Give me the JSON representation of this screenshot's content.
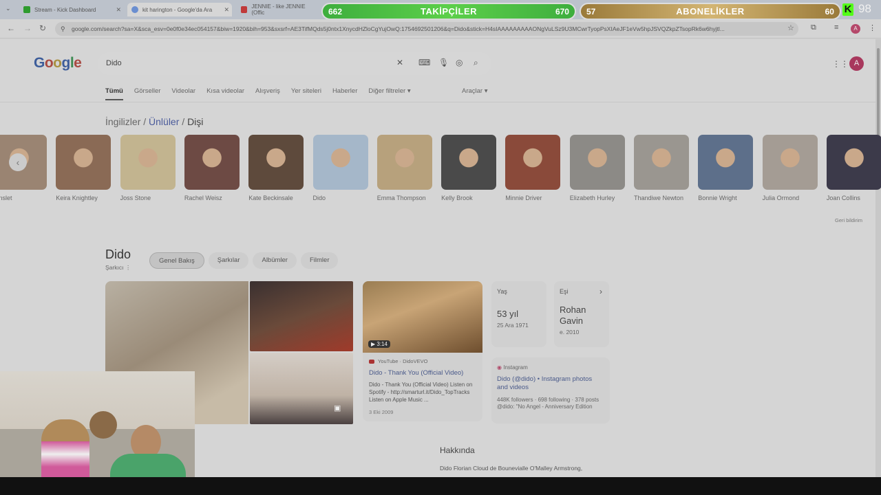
{
  "browser": {
    "tabs": [
      {
        "title": "Stream - Kick Dashboard",
        "color": "#53fc18"
      },
      {
        "title": "kit harington - Google'da Ara",
        "color": "#4285f4"
      },
      {
        "title": "JENNIE - like JENNIE (Offic",
        "color": "#e53935"
      }
    ],
    "url": "google.com/search?sa=X&sca_esv=0e0f0e34ec054157&biw=1920&bih=953&sxsrf=AE3TifMQds5j0ntx1XnycdHZloCgYujOwQ:1754692501206&q=Dido&stick=H4sIAAAAAAAAAONgVuLSz9U3MCwrTyopPsXIAeJF1eVw5hpJSVQZkpZTsopRk6w6hyjtl...",
    "profile_initial": "A"
  },
  "overlay": {
    "followers": {
      "label": "TAKİPÇİLER",
      "current": "662",
      "goal": "670"
    },
    "subscribers": {
      "label": "ABONELİKLER",
      "current": "57",
      "goal": "60"
    },
    "kick_logo": "K",
    "kick_count": "98"
  },
  "google": {
    "search_query": "Dido",
    "avatar_initial": "A",
    "filters": [
      "Tümü",
      "Görseller",
      "Videolar",
      "Kısa videolar",
      "Alışveriş",
      "Yer siteleri",
      "Haberler",
      "Diğer filtreler"
    ],
    "more_filters_caret": "▾",
    "tools": "Araçlar ▾",
    "breadcrumb": {
      "a": "İngilizler",
      "b": "Ünlüler",
      "c": "Dişi"
    },
    "people": [
      {
        "name": "Winslet",
        "color": "#9a8472"
      },
      {
        "name": "Keira Knightley",
        "color": "#8a6a55"
      },
      {
        "name": "Joss Stone",
        "color": "#c2b48f"
      },
      {
        "name": "Rachel Weisz",
        "color": "#6d4a44"
      },
      {
        "name": "Kate Beckinsale",
        "color": "#5e4a3c"
      },
      {
        "name": "Dido",
        "color": "#a5b7c9"
      },
      {
        "name": "Emma Thompson",
        "color": "#b7a17c"
      },
      {
        "name": "Kelly Brook",
        "color": "#4a4a4a"
      },
      {
        "name": "Minnie Driver",
        "color": "#8a4a3a"
      },
      {
        "name": "Elizabeth Hurley",
        "color": "#8c8a86"
      },
      {
        "name": "Thandiwe Newton",
        "color": "#9a9690"
      },
      {
        "name": "Bonnie Wright",
        "color": "#5d6f8a"
      },
      {
        "name": "Julia Ormond",
        "color": "#a49c94"
      },
      {
        "name": "Joan Collins",
        "color": "#3c3a4a"
      }
    ],
    "feedback": "Geri bildirim",
    "entity": {
      "title": "Dido",
      "subtitle": "Şarkıcı",
      "chips": [
        "Genel Bakış",
        "Şarkılar",
        "Albümler",
        "Filmler"
      ]
    },
    "video": {
      "duration": "▶ 3:14",
      "source": "YouTube · DidoVEVO",
      "title": "Dido - Thank You (Official Video)",
      "desc": "Dido - Thank You (Official Video) Listen on Spotify - http://smarturl.it/Dido_TopTracks Listen on Apple Music ...",
      "date": "3 Eki 2009"
    },
    "age": {
      "label": "Yaş",
      "value": "53 yıl",
      "sub": "25 Ara 1971"
    },
    "spouse": {
      "label": "Eşi",
      "value": "Rohan Gavin",
      "sub": "e. 2010",
      "arrow": "›"
    },
    "instagram": {
      "source": "Instagram",
      "title": "Dido (@dido) • Instagram photos and videos",
      "stats": "448K followers · 698 following · 378 posts",
      "bio": "@dido: \"No Angel - Anniversary Edition"
    },
    "about_title": "Hakkında",
    "about_text": "Dido Florian Cloud de Bounevialle O'Malley Armstrong,"
  }
}
